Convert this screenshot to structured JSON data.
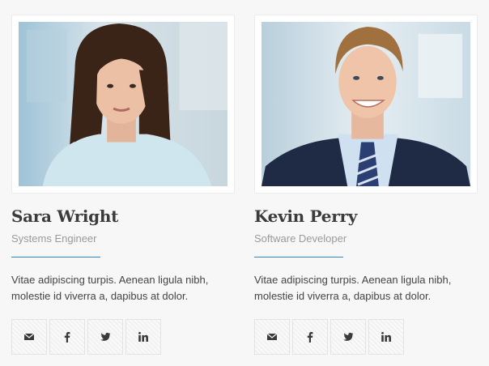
{
  "team": [
    {
      "name": "Sara Wright",
      "role": "Systems Engineer",
      "bio": "Vitae adipiscing turpis. Aenean ligula nibh, molestie id viverra a, dapibus at dolor.",
      "socials": [
        "email-icon",
        "facebook-icon",
        "twitter-icon",
        "linkedin-icon"
      ]
    },
    {
      "name": "Kevin Perry",
      "role": "Software Developer",
      "bio": "Vitae adipiscing turpis. Aenean ligula nibh, molestie id viverra a, dapibus at dolor.",
      "socials": [
        "email-icon",
        "facebook-icon",
        "twitter-icon",
        "linkedin-icon"
      ]
    }
  ],
  "colors": {
    "accent": "#2a86c9",
    "name_text": "#3b3b3b",
    "role_text": "#9a9a9a",
    "icon": "#3a3a3a"
  }
}
